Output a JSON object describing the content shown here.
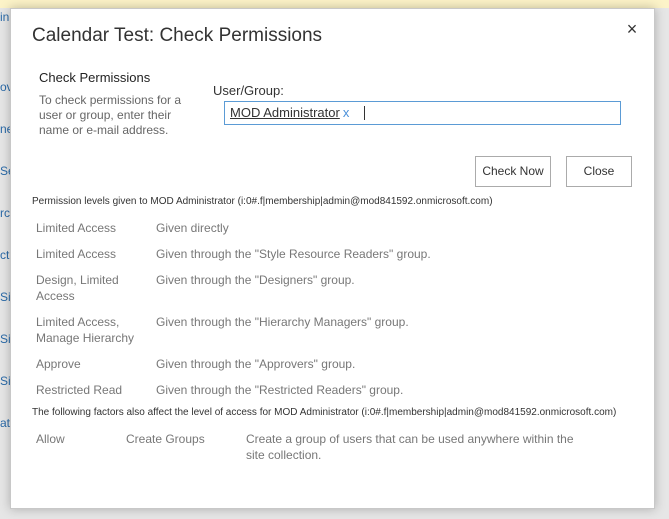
{
  "background": {
    "fragments": [
      "in",
      "ove",
      "ne",
      "Se",
      "rch",
      "ctu",
      "Si",
      "Si",
      "Si",
      "at"
    ]
  },
  "dialog": {
    "title": "Calendar Test: Check Permissions",
    "close_icon": "×",
    "section_title": "Check Permissions",
    "section_description": "To check permissions for a user or group, enter their name or e-mail address.",
    "user_group_label": "User/Group:",
    "selected_user": "MOD Administrator",
    "remove_user": "x",
    "check_now_label": "Check Now",
    "close_label": "Close"
  },
  "permissions": {
    "heading": "Permission levels given to MOD Administrator (i:0#.f|membership|admin@mod841592.onmicrosoft.com)",
    "rows": [
      {
        "level": "Limited Access",
        "source": "Given directly"
      },
      {
        "level": "Limited Access",
        "source": "Given through the \"Style Resource Readers\" group."
      },
      {
        "level": "Design, Limited Access",
        "source": "Given through the \"Designers\" group."
      },
      {
        "level": "Limited Access, Manage Hierarchy",
        "source": "Given through the \"Hierarchy Managers\" group."
      },
      {
        "level": "Approve",
        "source": "Given through the \"Approvers\" group."
      },
      {
        "level": "Restricted Read",
        "source": "Given through the \"Restricted Readers\" group."
      }
    ]
  },
  "factors": {
    "heading": "The following factors also affect the level of access for MOD Administrator (i:0#.f|membership|admin@mod841592.onmicrosoft.com)",
    "rows": [
      {
        "effect": "Allow",
        "permission": "Create Groups",
        "description": "Create a group of users that can be used anywhere within the site collection."
      }
    ]
  }
}
